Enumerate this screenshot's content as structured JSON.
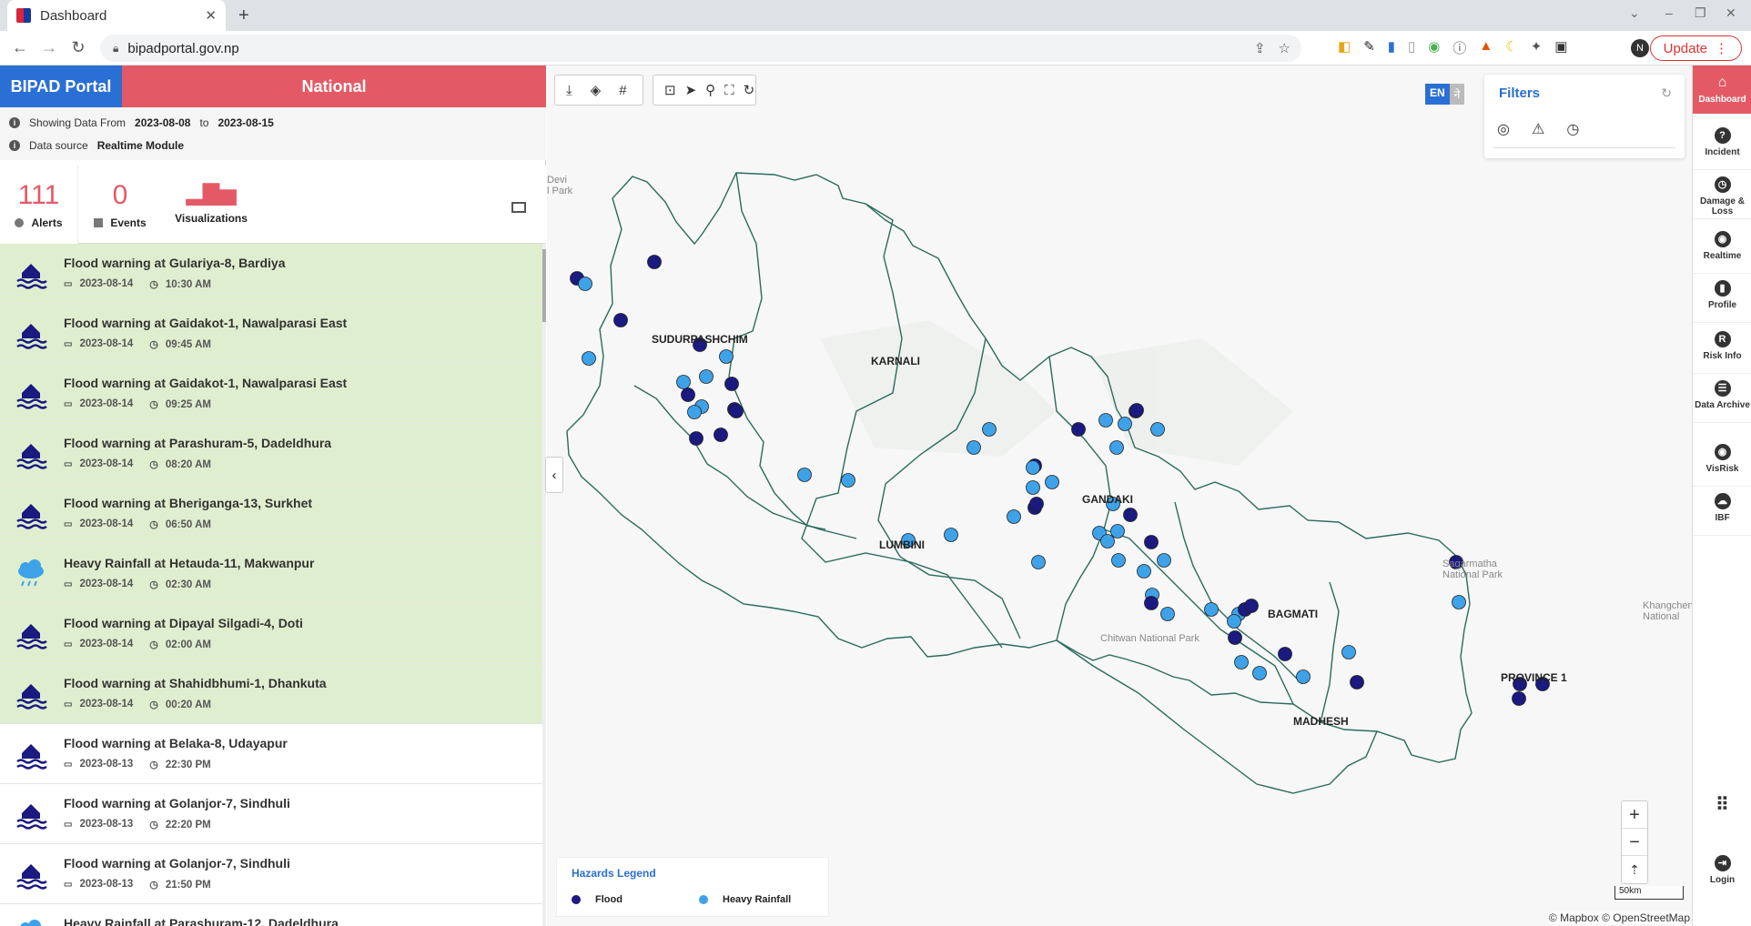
{
  "browser": {
    "tab_title": "Dashboard",
    "url": "bipadportal.gov.np",
    "update_label": "Update",
    "profile_initial": "N"
  },
  "header": {
    "brand": "BIPAD Portal",
    "scope": "National"
  },
  "info": {
    "showing_label": "Showing Data From",
    "date_from": "2023-08-08",
    "to_label": "to",
    "date_to": "2023-08-15",
    "source_label": "Data source",
    "source_value": "Realtime Module"
  },
  "stats": {
    "alerts_count": "111",
    "alerts_label": "Alerts",
    "events_count": "0",
    "events_label": "Events",
    "visualizations_label": "Visualizations"
  },
  "alerts": [
    {
      "title": "Flood warning at Gulariya-8, Bardiya",
      "date": "2023-08-14",
      "time": "10:30 AM",
      "type": "flood",
      "highlight": true
    },
    {
      "title": "Flood warning at Gaidakot-1, Nawalparasi East",
      "date": "2023-08-14",
      "time": "09:45 AM",
      "type": "flood",
      "highlight": true
    },
    {
      "title": "Flood warning at Gaidakot-1, Nawalparasi East",
      "date": "2023-08-14",
      "time": "09:25 AM",
      "type": "flood",
      "highlight": true
    },
    {
      "title": "Flood warning at Parashuram-5, Dadeldhura",
      "date": "2023-08-14",
      "time": "08:20 AM",
      "type": "flood",
      "highlight": true
    },
    {
      "title": "Flood warning at Bheriganga-13, Surkhet",
      "date": "2023-08-14",
      "time": "06:50 AM",
      "type": "flood",
      "highlight": true
    },
    {
      "title": "Heavy Rainfall at Hetauda-11, Makwanpur",
      "date": "2023-08-14",
      "time": "02:30 AM",
      "type": "rain",
      "highlight": true
    },
    {
      "title": "Flood warning at Dipayal Silgadi-4, Doti",
      "date": "2023-08-14",
      "time": "02:00 AM",
      "type": "flood",
      "highlight": true
    },
    {
      "title": "Flood warning at Shahidbhumi-1, Dhankuta",
      "date": "2023-08-14",
      "time": "00:20 AM",
      "type": "flood",
      "highlight": true
    },
    {
      "title": "Flood warning at Belaka-8, Udayapur",
      "date": "2023-08-13",
      "time": "22:30 PM",
      "type": "flood",
      "highlight": false
    },
    {
      "title": "Flood warning at Golanjor-7, Sindhuli",
      "date": "2023-08-13",
      "time": "22:20 PM",
      "type": "flood",
      "highlight": false
    },
    {
      "title": "Flood warning at Golanjor-7, Sindhuli",
      "date": "2023-08-13",
      "time": "21:50 PM",
      "type": "flood",
      "highlight": false
    },
    {
      "title": "Heavy Rainfall at Parashuram-12, Dadeldhura",
      "date": "",
      "time": "",
      "type": "rain",
      "highlight": false
    }
  ],
  "map": {
    "regions": [
      "SUDURPASHCHIM",
      "KARNALI",
      "LUMBINI",
      "GANDAKI",
      "BAGMATI",
      "MADHESH",
      "PROVINCE 1"
    ],
    "park_labels": [
      "Devi\nl Park",
      "Chitwan National Park",
      "Sagarmatha\nNational Park",
      "Khangchen\nNational"
    ],
    "lang_en": "EN",
    "lang_np": "ने",
    "filters_title": "Filters",
    "legend_title": "Hazards Legend",
    "legend_flood": "Flood",
    "legend_rain": "Heavy Rainfall",
    "scale": "50km",
    "attribution": "© Mapbox © OpenStreetMap",
    "colors": {
      "flood": "#1a1a80",
      "rain": "#3ea2e8"
    }
  },
  "sidebar": [
    {
      "label": "Dashboard",
      "icon": "home-icon"
    },
    {
      "label": "Incident",
      "icon": "question-icon"
    },
    {
      "label": "Damage & Loss",
      "icon": "clock-icon"
    },
    {
      "label": "Realtime",
      "icon": "signal-icon"
    },
    {
      "label": "Profile",
      "icon": "bar-chart-icon"
    },
    {
      "label": "Risk Info",
      "icon": "risk-icon"
    },
    {
      "label": "Data Archive",
      "icon": "clipboard-icon"
    },
    {
      "label": "VisRisk",
      "icon": "eye-icon"
    },
    {
      "label": "IBF",
      "icon": "cloud-icon"
    },
    {
      "label": "Login",
      "icon": "login-icon"
    }
  ]
}
